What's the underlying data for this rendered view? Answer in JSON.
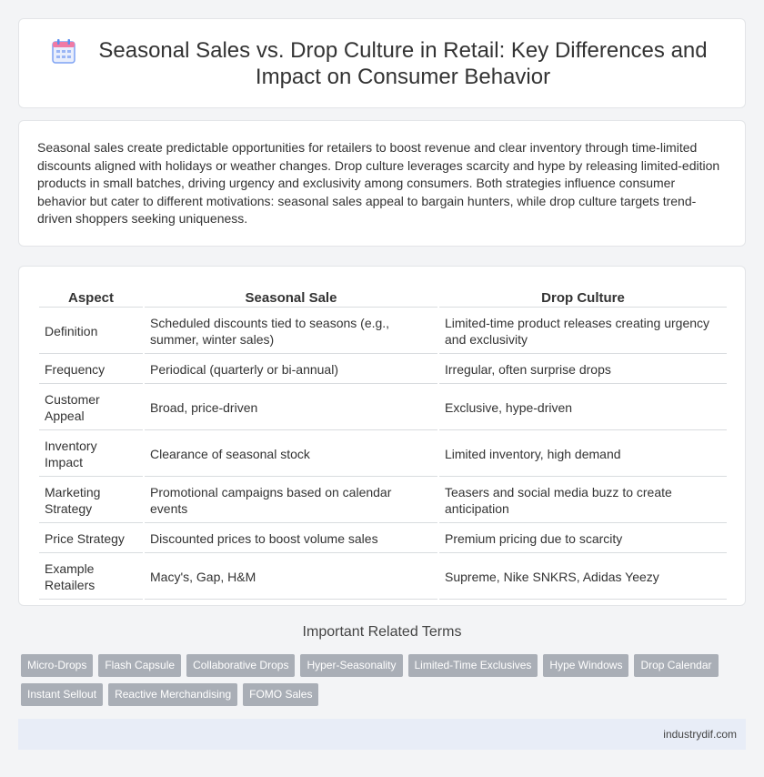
{
  "header": {
    "icon": "calendar-icon",
    "title": "Seasonal Sales vs. Drop Culture in Retail: Key Differences and Impact on Consumer Behavior"
  },
  "intro": "Seasonal sales create predictable opportunities for retailers to boost revenue and clear inventory through time-limited discounts aligned with holidays or weather changes. Drop culture leverages scarcity and hype by releasing limited-edition products in small batches, driving urgency and exclusivity among consumers. Both strategies influence consumer behavior but cater to different motivations: seasonal sales appeal to bargain hunters, while drop culture targets trend-driven shoppers seeking uniqueness.",
  "table": {
    "headers": [
      "Aspect",
      "Seasonal Sale",
      "Drop Culture"
    ],
    "rows": [
      [
        "Definition",
        "Scheduled discounts tied to seasons (e.g., summer, winter sales)",
        "Limited-time product releases creating urgency and exclusivity"
      ],
      [
        "Frequency",
        "Periodical (quarterly or bi-annual)",
        "Irregular, often surprise drops"
      ],
      [
        "Customer Appeal",
        "Broad, price-driven",
        "Exclusive, hype-driven"
      ],
      [
        "Inventory Impact",
        "Clearance of seasonal stock",
        "Limited inventory, high demand"
      ],
      [
        "Marketing Strategy",
        "Promotional campaigns based on calendar events",
        "Teasers and social media buzz to create anticipation"
      ],
      [
        "Price Strategy",
        "Discounted prices to boost volume sales",
        "Premium pricing due to scarcity"
      ],
      [
        "Example Retailers",
        "Macy's, Gap, H&M",
        "Supreme, Nike SNKRS, Adidas Yeezy"
      ]
    ]
  },
  "related": {
    "title": "Important Related Terms",
    "tags": [
      "Micro-Drops",
      "Flash Capsule",
      "Collaborative Drops",
      "Hyper-Seasonality",
      "Limited-Time Exclusives",
      "Hype Windows",
      "Drop Calendar",
      "Instant Sellout",
      "Reactive Merchandising",
      "FOMO Sales"
    ]
  },
  "footer": {
    "site": "industrydif.com"
  },
  "colors": {
    "tag_bg": "#a9aeb6",
    "footer_bg": "#e8edf7",
    "icon_blue": "#5b8def",
    "icon_pink": "#f07aa4"
  }
}
